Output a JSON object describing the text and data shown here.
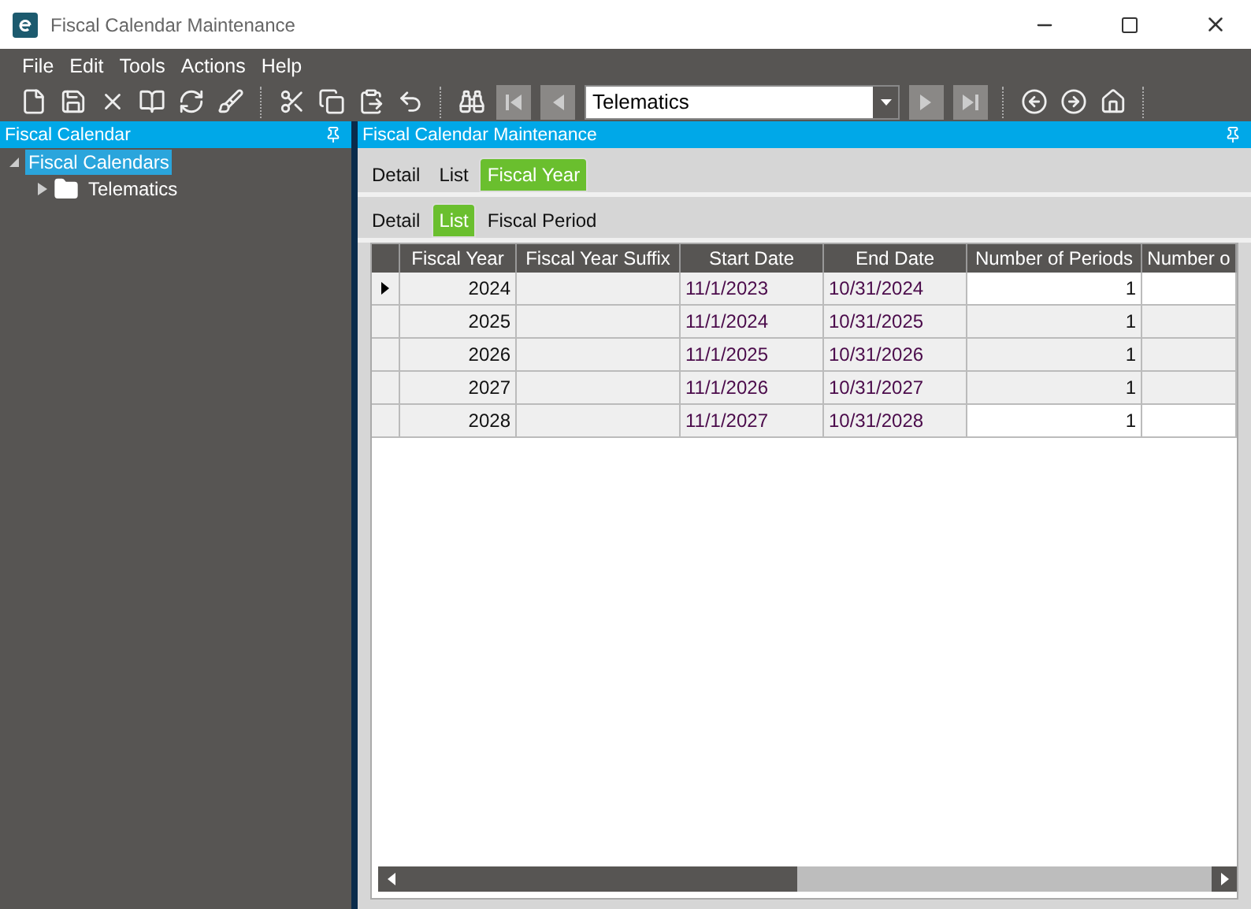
{
  "window": {
    "title": "Fiscal Calendar Maintenance"
  },
  "menu": [
    "File",
    "Edit",
    "Tools",
    "Actions",
    "Help"
  ],
  "toolbar": {
    "record_selector": "Telematics"
  },
  "left_panel": {
    "title": "Fiscal Calendar",
    "tree": [
      {
        "label": "Fiscal Calendars",
        "selected": true,
        "expanded": true,
        "children": [
          {
            "label": "Telematics",
            "selected": false,
            "expanded": false
          }
        ]
      }
    ]
  },
  "main_panel": {
    "title": "Fiscal Calendar Maintenance",
    "tabs": [
      {
        "label": "Detail",
        "selected": false
      },
      {
        "label": "List",
        "selected": false
      },
      {
        "label": "Fiscal Year",
        "selected": true
      }
    ],
    "subtabs": [
      {
        "label": "Detail",
        "selected": false
      },
      {
        "label": "List",
        "selected": true
      },
      {
        "label": "Fiscal Period",
        "selected": false
      }
    ],
    "table": {
      "columns": [
        "Fiscal Year",
        "Fiscal Year Suffix",
        "Start Date",
        "End Date",
        "Number of Periods",
        "Number o"
      ],
      "rows": [
        {
          "selected": true,
          "cells": [
            "2024",
            "",
            "11/1/2023",
            "10/31/2024",
            "1",
            ""
          ]
        },
        {
          "selected": false,
          "cells": [
            "2025",
            "",
            "11/1/2024",
            "10/31/2025",
            "1",
            ""
          ]
        },
        {
          "selected": false,
          "cells": [
            "2026",
            "",
            "11/1/2025",
            "10/31/2026",
            "1",
            ""
          ]
        },
        {
          "selected": false,
          "cells": [
            "2027",
            "",
            "11/1/2026",
            "10/31/2027",
            "1",
            ""
          ]
        },
        {
          "selected": false,
          "cells": [
            "2028",
            "",
            "11/1/2027",
            "10/31/2028",
            "1",
            ""
          ]
        }
      ]
    }
  }
}
